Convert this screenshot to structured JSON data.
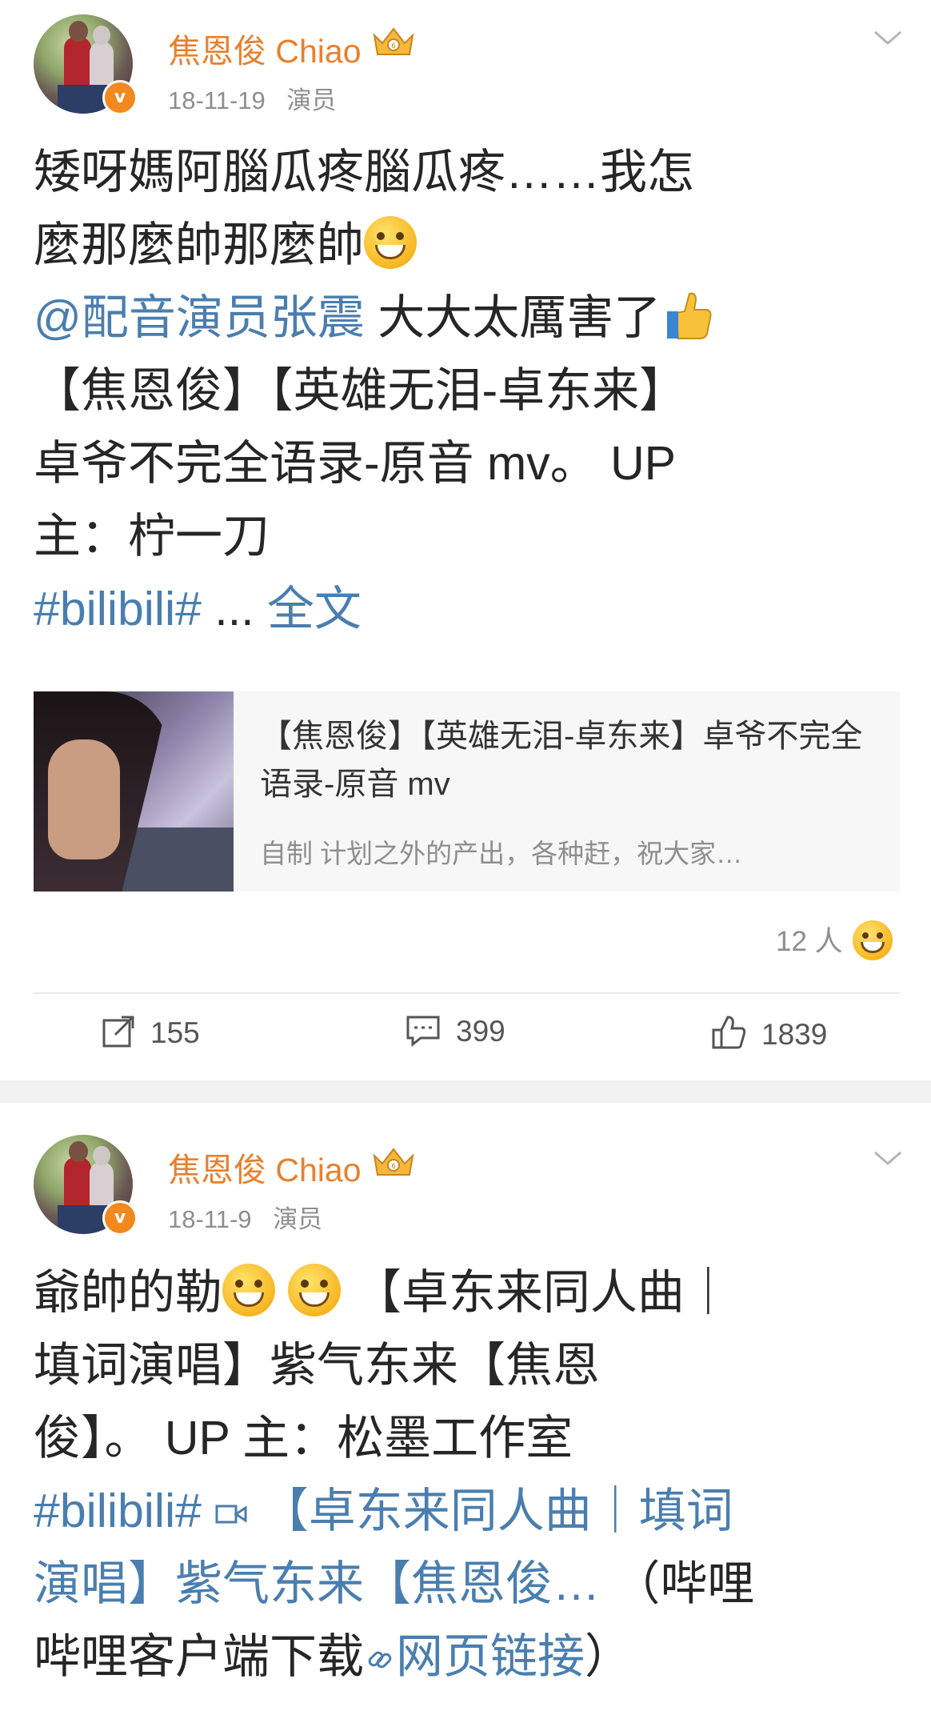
{
  "posts": [
    {
      "author": "焦恩俊 Chiao",
      "date": "18-11-19",
      "source": "演员",
      "text_line1": "矮呀媽阿腦瓜疼腦瓜疼……我怎",
      "text_line2": "麼那麼帥那麼帥",
      "mention": "@配音演员张震",
      "text_line3": " 大大太厲害了",
      "text_line4": "【焦恩俊】【英雄无泪-卓东来】",
      "text_line5": "卓爷不完全语录-原音 mv。 UP",
      "text_line6": "主：柠一刀",
      "hashtag": "#bilibili#",
      "ellipsis": " ... ",
      "full_text": "全文",
      "card": {
        "title": "【焦恩俊】【英雄无泪-卓东来】卓爷不完全语录-原音 mv",
        "desc": "自制  计划之外的产出，各种赶，祝大家…"
      },
      "reactions": "12 人",
      "repost_count": "155",
      "comment_count": "399",
      "like_count": "1839"
    },
    {
      "author": "焦恩俊 Chiao",
      "date": "18-11-9",
      "source": "演员",
      "text_line1_a": "爺帥的勒",
      "text_line1_b": " 【卓东来同人曲｜",
      "text_line2": "填词演唱】紫气东来【焦恩",
      "text_line3": "俊】。 UP 主：松墨工作室",
      "hashtag": "#bilibili#",
      "video_link_line1": "【卓东来同人曲｜填词",
      "video_link_line2": "演唱】紫气东来【焦恩俊…",
      "after_link": " （哔哩",
      "text_line6_a": "哔哩客户端下载",
      "web_link": "网页链接",
      "text_line6_b": "）"
    }
  ],
  "colors": {
    "name_orange": "#e8802d",
    "link_blue": "#4a7eaf",
    "meta_gray": "#8e8e8e",
    "separator": "#f2f2f2"
  },
  "icons": [
    "verified-v-icon",
    "crown-icon",
    "chevron-down-icon",
    "grin-emoji-icon",
    "thumbs-up-emoji-icon",
    "repost-icon",
    "comment-icon",
    "like-icon",
    "video-icon",
    "link-icon"
  ]
}
